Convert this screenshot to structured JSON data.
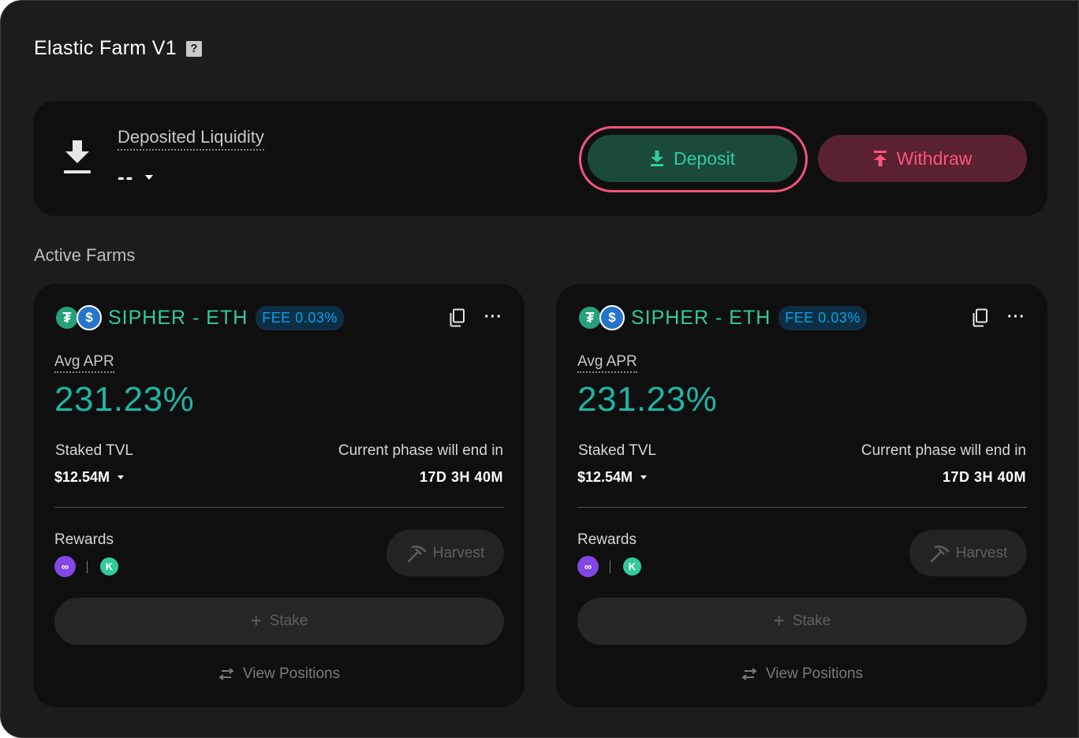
{
  "header": {
    "title": "Elastic Farm V1",
    "help_icon": "question-icon"
  },
  "liquidity": {
    "label": "Deposited Liquidity",
    "value": "--",
    "deposit_label": "Deposit",
    "withdraw_label": "Withdraw",
    "colors": {
      "deposit": "#31cb9e",
      "withdraw": "#ff537b",
      "highlight_ring": "#f2547b"
    }
  },
  "section_title": "Active Farms",
  "farms": [
    {
      "pair": "SIPHER - ETH",
      "fee": "FEE 0.03%",
      "apr_label": "Avg APR",
      "apr": "231.23%",
      "tvl_label": "Staked TVL",
      "tvl": "$12.54M",
      "phase_label": "Current phase will end in",
      "phase_value": "17D 3H 40M",
      "rewards_label": "Rewards",
      "harvest_label": "Harvest",
      "stake_label": "Stake",
      "view_positions_label": "View Positions"
    },
    {
      "pair": "SIPHER - ETH",
      "fee": "FEE 0.03%",
      "apr_label": "Avg APR",
      "apr": "231.23%",
      "tvl_label": "Staked TVL",
      "tvl": "$12.54M",
      "phase_label": "Current phase will end in",
      "phase_value": "17D 3H 40M",
      "rewards_label": "Rewards",
      "harvest_label": "Harvest",
      "stake_label": "Stake",
      "view_positions_label": "View Positions"
    }
  ]
}
